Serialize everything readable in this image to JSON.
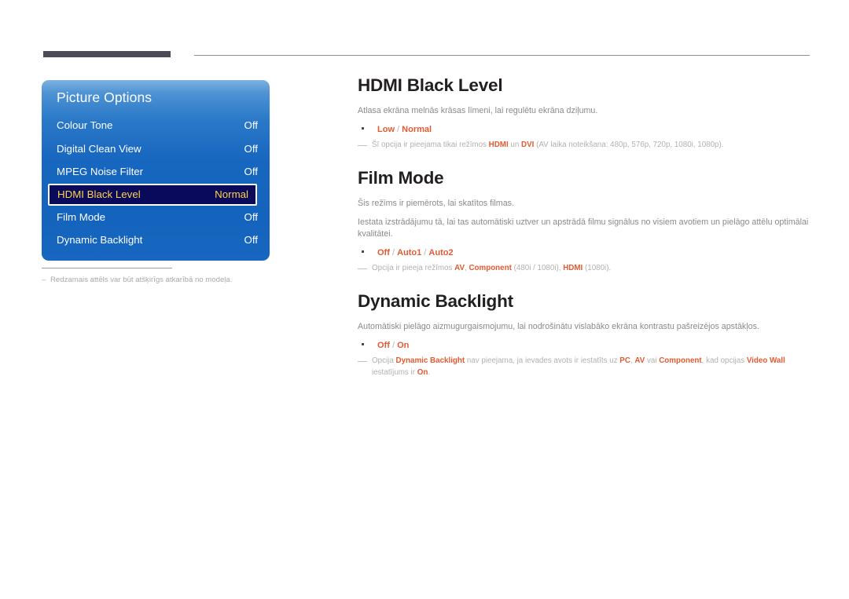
{
  "header": {
    "thick_rule": "decorative-thick-bar",
    "thin_rule": "decorative-thin-rule"
  },
  "menu_panel": {
    "title": "Picture Options",
    "rows": [
      {
        "label": "Colour Tone",
        "value": "Off",
        "selected": false
      },
      {
        "label": "Digital Clean View",
        "value": "Off",
        "selected": false
      },
      {
        "label": "MPEG Noise Filter",
        "value": "Off",
        "selected": false
      },
      {
        "label": "HDMI Black Level",
        "value": "Normal",
        "selected": true
      },
      {
        "label": "Film Mode",
        "value": "Off",
        "selected": false
      },
      {
        "label": "Dynamic Backlight",
        "value": "Off",
        "selected": false
      }
    ],
    "colors": {
      "gradient_top": "#7fb2e0",
      "gradient_bottom": "#1767c0",
      "selected_bg": "#0a0a5a",
      "selected_text": "#ffd24d",
      "selected_border": "#ffffff"
    }
  },
  "left_footnote": {
    "dash": "–",
    "text": "Redzamais attēls var būt atšķirīgs atkarībā no modeļa."
  },
  "sections": [
    {
      "title": "HDMI Black Level",
      "paragraphs": [
        "Atlasa ekrāna melnās krāsas līmeni, lai regulētu ekrāna dziļumu."
      ],
      "options": [
        {
          "name": "Low"
        },
        {
          "sep": " / "
        },
        {
          "name": "Normal"
        }
      ],
      "options_plain": "Low / Normal",
      "note_parts": [
        {
          "type": "plain",
          "text": "Šī opcija ir pieejama tikai režīmos "
        },
        {
          "type": "bold",
          "text": "HDMI"
        },
        {
          "type": "plain",
          "text": " un "
        },
        {
          "type": "bold",
          "text": "DVI"
        },
        {
          "type": "plain",
          "text": " (AV laika noteikšana: 480p, 576p, 720p, 1080i, 1080p)."
        }
      ]
    },
    {
      "title": "Film Mode",
      "paragraphs": [
        "Šis režīms ir piemērots, lai skatītos filmas.",
        "Iestata izstrādājumu tā, lai tas automātiski uztver un apstrādā filmu signālus no visiem avotiem un pielāgo attēlu optimālai kvalitātei."
      ],
      "options_plain": "Off / Auto1 / Auto2",
      "note_parts": [
        {
          "type": "plain",
          "text": "Opcija ir pieeja režīmos "
        },
        {
          "type": "bold",
          "text": "AV"
        },
        {
          "type": "plain",
          "text": ", "
        },
        {
          "type": "bold",
          "text": "Component"
        },
        {
          "type": "plain",
          "text": " (480i / 1080i), "
        },
        {
          "type": "bold",
          "text": "HDMI"
        },
        {
          "type": "plain",
          "text": " (1080i)."
        }
      ]
    },
    {
      "title": "Dynamic Backlight",
      "paragraphs": [
        "Automātiski pielāgo aizmugurgaismojumu, lai nodrošinātu vislabāko ekrāna kontrastu pašreizējos apstākļos."
      ],
      "options_plain": "Off / On",
      "note_parts": [
        {
          "type": "plain",
          "text": "Opcija "
        },
        {
          "type": "bold",
          "text": "Dynamic Backlight"
        },
        {
          "type": "plain",
          "text": " nav pieejama, ja ievades avots ir iestatīts uz "
        },
        {
          "type": "bold",
          "text": "PC"
        },
        {
          "type": "plain",
          "text": ", "
        },
        {
          "type": "bold",
          "text": "AV"
        },
        {
          "type": "plain",
          "text": " vai "
        },
        {
          "type": "bold",
          "text": "Component"
        },
        {
          "type": "plain",
          "text": ", kad opcijas "
        },
        {
          "type": "bold",
          "text": "Video Wall"
        },
        {
          "type": "plain",
          "text": " iestatījums ir "
        },
        {
          "type": "bold",
          "text": "On"
        },
        {
          "type": "plain",
          "text": "."
        }
      ]
    }
  ],
  "accent_color": "#e05a33"
}
